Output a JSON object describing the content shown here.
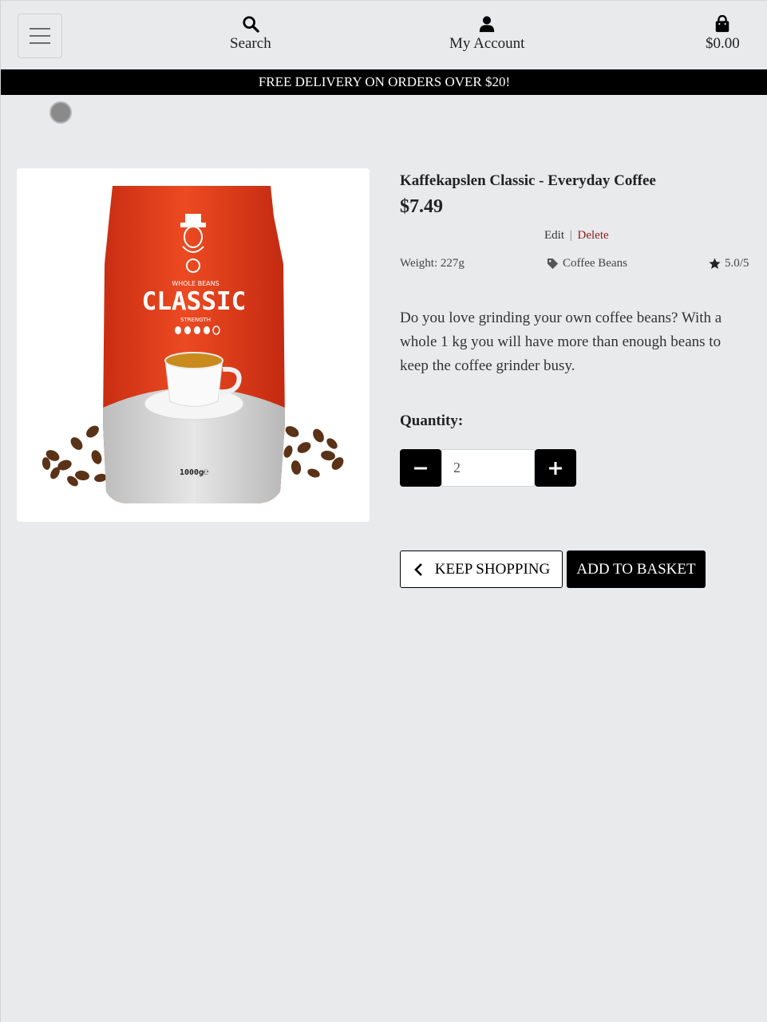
{
  "header": {
    "search_label": "Search",
    "account_label": "My Account",
    "basket_total": "$0.00"
  },
  "promo": {
    "text": "FREE DELIVERY ON ORDERS OVER $20!"
  },
  "product": {
    "name": "Kaffekapslen Classic - Everyday Coffee",
    "price": "$7.49",
    "edit_label": "Edit",
    "separator": "|",
    "delete_label": "Delete",
    "weight": "Weight: 227g",
    "category": "Coffee Beans",
    "rating": "5.0/5",
    "description": "Do you love grinding your own coffee beans? With a whole 1 kg you will have more than enough beans to keep the coffee grinder busy.",
    "image": {
      "bag_small_text": "WHOLE BEANS",
      "bag_title": "CLASSIC",
      "bag_subtitle": "STRENGTH",
      "bag_weight": "1000g℮"
    }
  },
  "quantity": {
    "label": "Quantity:",
    "value": "2"
  },
  "actions": {
    "keep_shopping": "KEEP SHOPPING",
    "add_to_basket": "ADD TO BASKET"
  },
  "colors": {
    "bag_red": "#e23a1a",
    "accent_delete": "#8b1a1a",
    "page_bg": "#e9eaec"
  }
}
